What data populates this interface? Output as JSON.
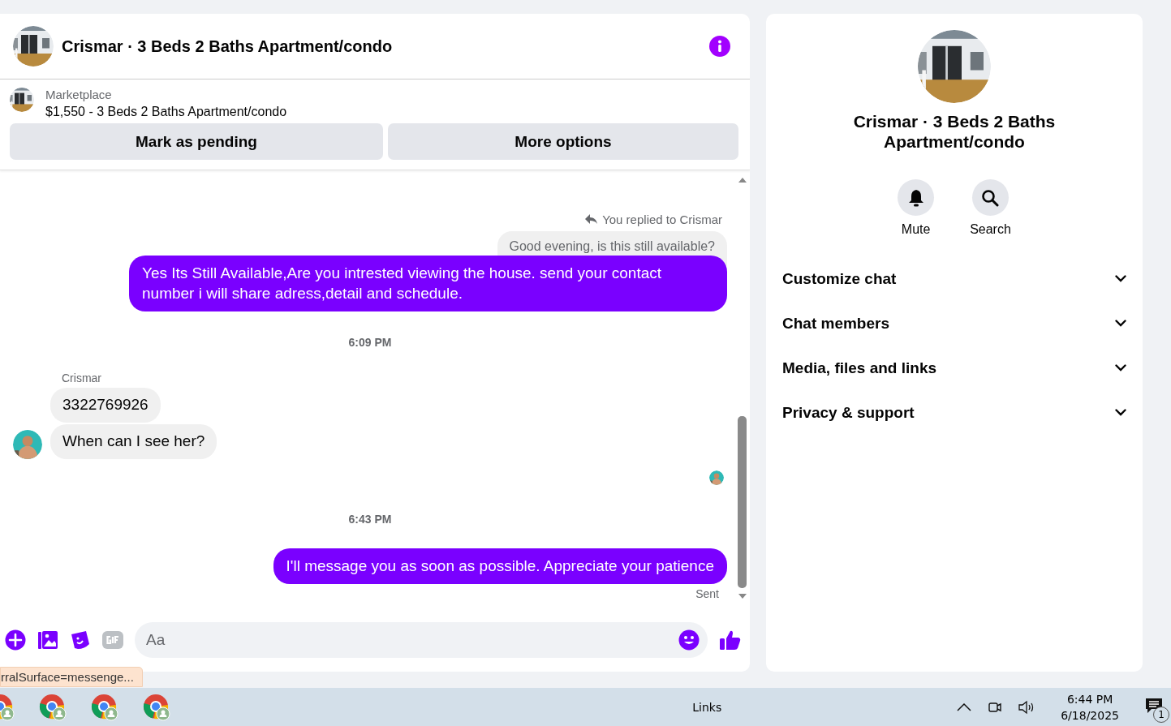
{
  "chat": {
    "title": "Crismar · 3 Beds 2 Baths Apartment/condo",
    "listing": {
      "source": "Marketplace",
      "summary": "$1,550 - 3 Beds 2 Baths Apartment/condo"
    },
    "actions": [
      "Mark as pending",
      "More options"
    ],
    "messages": [
      {
        "kind": "reply_note",
        "text": "You replied to Crismar"
      },
      {
        "kind": "quoted",
        "text": "Good evening, is this still available?"
      },
      {
        "kind": "outgoing",
        "text": "Yes Its Still Available,Are you intrested viewing the house. send your contact number i will share adress,detail and schedule."
      },
      {
        "kind": "time",
        "text": "6:09 PM"
      },
      {
        "kind": "sender",
        "text": "Crismar"
      },
      {
        "kind": "incoming",
        "text": "3322769926",
        "avatar": false
      },
      {
        "kind": "incoming",
        "text": "When can I see her?",
        "avatar": true
      },
      {
        "kind": "seen"
      },
      {
        "kind": "time",
        "text": "6:43 PM"
      },
      {
        "kind": "outgoing",
        "text": "I'll message you as soon as possible. Appreciate your patience"
      },
      {
        "kind": "status",
        "text": "Sent"
      }
    ],
    "composer": {
      "placeholder": "Aa"
    }
  },
  "details": {
    "title": "Crismar · 3 Beds 2 Baths Apartment/condo",
    "buttons": [
      {
        "kind": "mute",
        "label": "Mute"
      },
      {
        "kind": "search",
        "label": "Search"
      }
    ],
    "sections": [
      {
        "label": "Customize chat",
        "expanded": false
      },
      {
        "label": "Chat members",
        "expanded": false
      },
      {
        "label": "Media, files and links",
        "expanded": false
      },
      {
        "label": "Privacy & support",
        "expanded": false
      }
    ]
  },
  "status_link": "rralSurface=messenge...",
  "taskbar": {
    "toolbar": "Links",
    "time": "6:44 PM",
    "date": "6/18/2025",
    "notifications": "1"
  }
}
